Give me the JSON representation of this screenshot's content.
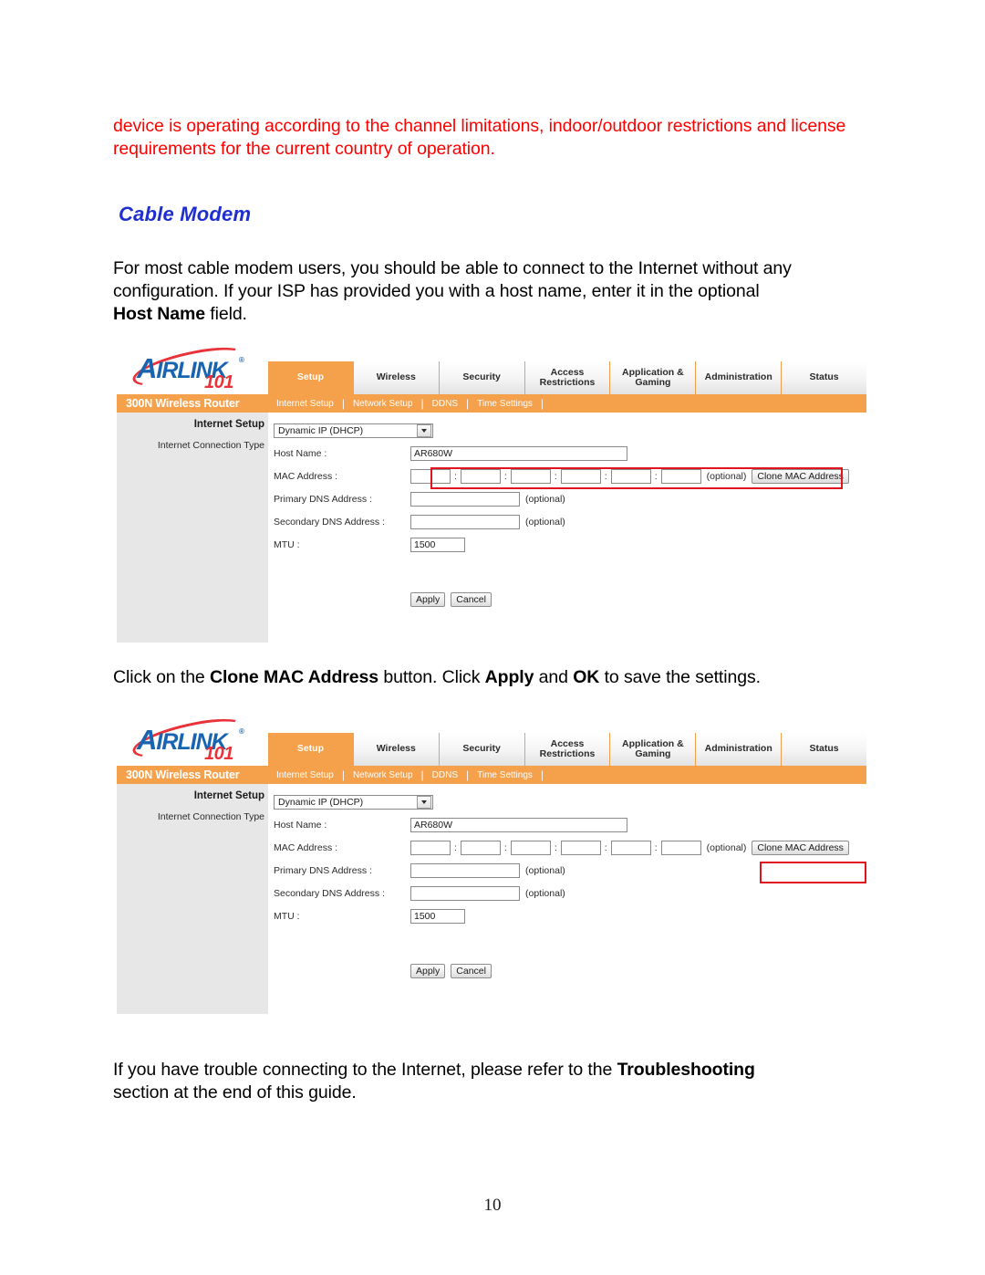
{
  "document": {
    "warning_text": "device is operating according to the channel limitations, indoor/outdoor restrictions and license requirements for the current country of operation.",
    "heading": "Cable Modem",
    "intro_line1": "For most cable modem users, you should be able to connect to the Internet without any",
    "intro_line2": "configuration. If your ISP has provided you with a host name, enter it in the optional",
    "intro_bold": "Host Name",
    "intro_tail": " field.",
    "mid_pre": "Click on the ",
    "mid_bold1": "Clone MAC Address",
    "mid_mid": " button. Click ",
    "mid_bold2": "Apply",
    "mid_and": " and ",
    "mid_bold3": "OK",
    "mid_tail": " to save the settings.",
    "end_pre": "If you have trouble connecting to the Internet, please refer to the ",
    "end_bold": "Troubleshooting",
    "end_tail": "section at the end of this guide.",
    "page_number": "10"
  },
  "router_ui": {
    "logo": {
      "brand_a": "A",
      "brand_rest": "IRLINK",
      "registered": "®",
      "model_number": "101"
    },
    "tabs": [
      {
        "label": "Setup",
        "active": true
      },
      {
        "label": "Wireless",
        "active": false
      },
      {
        "label": "Security",
        "active": false
      },
      {
        "label": "Access Restrictions",
        "active": false
      },
      {
        "label": "Application & Gaming",
        "active": false
      },
      {
        "label": "Administration",
        "active": false
      },
      {
        "label": "Status",
        "active": false
      }
    ],
    "subnav": {
      "brand": "300N Wireless Router",
      "items": [
        "Internet Setup",
        "Network Setup",
        "DDNS",
        "Time Settings"
      ],
      "separator": "|"
    },
    "side_panel": {
      "title": "Internet Setup",
      "connection_type_label": "Internet Connection Type"
    },
    "form": {
      "connection_type_value": "Dynamic IP (DHCP)",
      "host_name_label": "Host Name :",
      "host_name_value": "AR680W",
      "mac_address_label": "MAC Address :",
      "mac_octets": [
        "",
        "",
        "",
        "",
        "",
        ""
      ],
      "mac_separator": ":",
      "primary_dns_label": "Primary DNS Address :",
      "primary_dns_value": "",
      "secondary_dns_label": "Secondary DNS Address :",
      "secondary_dns_value": "",
      "mtu_label": "MTU :",
      "mtu_value": "1500",
      "optional_text": "(optional)",
      "clone_mac_button": "Clone MAC Address",
      "apply_button": "Apply",
      "cancel_button": "Cancel"
    },
    "colors": {
      "nav_orange": "#f5a04b",
      "side_gray": "#e7e7e7",
      "highlight_red": "#e0141e",
      "logo_blue": "#1964b0",
      "logo_red": "#e8333a"
    }
  }
}
